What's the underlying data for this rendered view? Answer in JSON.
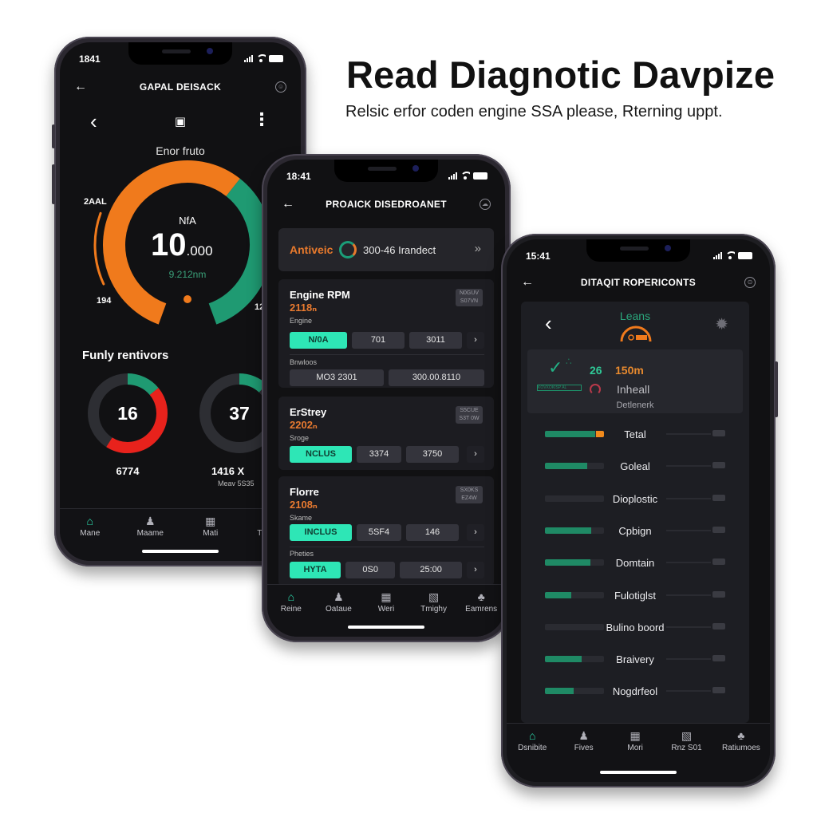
{
  "header": {
    "title": "Read Diagnotic Davpize",
    "subtitle": "Relsic erfor coden engine SSA please, Rterning uppt."
  },
  "colors": {
    "accent_teal": "#2ee6b6",
    "accent_green": "#1f8a65",
    "accent_orange": "#f07a1c",
    "alert_red": "#e8221c",
    "background_dark": "#111113"
  },
  "phone1": {
    "status_time": "1841",
    "title": "GAPAL DEISACK",
    "gauge": {
      "label": "Enor fruto",
      "unit": "NfA",
      "value_major": "10",
      "value_minor": ".000",
      "sub": "9.212nm",
      "scale_top_left": "2AAL",
      "scale_bottom_left": "194",
      "scale_bottom_right": "12",
      "orange_fraction": 0.62,
      "green_fraction": 0.38
    },
    "section_title": "Funly rentivors",
    "ring_left": {
      "value": "16",
      "caption": "6774",
      "red_fraction": 0.45,
      "green_fraction": 0.14
    },
    "ring_right": {
      "value": "37",
      "caption": "1416 X",
      "sub": "Meav 5S35",
      "green_fraction": 0.12
    },
    "tabs": [
      {
        "label": "Mane",
        "icon": "home-icon",
        "active": true
      },
      {
        "label": "Maame",
        "icon": "user-icon",
        "active": false
      },
      {
        "label": "Mati",
        "icon": "grid-icon",
        "active": false
      },
      {
        "label": "Trcpfilis",
        "icon": "map-icon",
        "active": false
      }
    ]
  },
  "phone2": {
    "status_time": "18:41",
    "title": "PROAICK DISEDROANET",
    "banner": {
      "brand": "Antiveic",
      "text": "300-46 Irandect"
    },
    "cards": [
      {
        "name": "Engine RPM",
        "value": "2118ₙ",
        "label": "Engine",
        "badge": [
          "N0GUV",
          "S07VN"
        ],
        "chips": [
          "N/0A",
          "701",
          "3011"
        ],
        "label2": "Bnwloos",
        "chips2": [
          "MO3 2301",
          "300.00.8110"
        ]
      },
      {
        "name": "ErStrey",
        "value": "2202ₙ",
        "label": "Sroge",
        "badge": [
          "S5CUE",
          "S3T 0W"
        ],
        "chips": [
          "NCLUS",
          "3374",
          "3750"
        ]
      },
      {
        "name": "Florre",
        "value": "2108ₙ",
        "label": "Skame",
        "badge": [
          "SX0KS",
          "EZ4W"
        ],
        "chips": [
          "INCLUS",
          "5SF4",
          "146"
        ],
        "label2": "Pheties",
        "chips2": [
          "HYTA",
          "0S0",
          "25:00"
        ]
      }
    ],
    "tabs": [
      {
        "label": "Reine",
        "icon": "home-icon",
        "active": true
      },
      {
        "label": "Oataue",
        "icon": "user-icon",
        "active": false
      },
      {
        "label": "Weri",
        "icon": "grid-icon",
        "active": false
      },
      {
        "label": "Tmighy",
        "icon": "map-icon",
        "active": false
      },
      {
        "label": "Eamrens",
        "icon": "puzzle-icon",
        "active": false
      }
    ]
  },
  "phone3": {
    "status_time": "15:41",
    "title": "DITAQIT ROPERICONTS",
    "panel": {
      "title": "Leans",
      "readout_a": "26",
      "readout_b": "150m",
      "status": "Inheall",
      "detail": "Detlenerk",
      "strip_text": "KOVXOKISP AL"
    },
    "sensors": [
      {
        "name": "Tetal",
        "fill": 0.85,
        "warn": true
      },
      {
        "name": "Goleal",
        "fill": 0.72,
        "warn": false
      },
      {
        "name": "Dioplostic",
        "fill": 0.0,
        "warn": false
      },
      {
        "name": "Cpbign",
        "fill": 0.78,
        "warn": false
      },
      {
        "name": "Domtain",
        "fill": 0.77,
        "warn": false
      },
      {
        "name": "Fulotiglst",
        "fill": 0.45,
        "warn": false
      },
      {
        "name": "Bulino boord",
        "fill": 0.0,
        "warn": false
      },
      {
        "name": "Braivery",
        "fill": 0.62,
        "warn": false
      },
      {
        "name": "Nogdrfeol",
        "fill": 0.48,
        "warn": false
      }
    ],
    "tabs": [
      {
        "label": "Dsnibite",
        "icon": "home-icon",
        "active": true
      },
      {
        "label": "Fives",
        "icon": "user-icon",
        "active": false
      },
      {
        "label": "Mori",
        "icon": "grid-icon",
        "active": false
      },
      {
        "label": "Rnz S01",
        "icon": "map-icon",
        "active": false
      },
      {
        "label": "Ratiumoes",
        "icon": "puzzle-icon",
        "active": false
      }
    ]
  }
}
